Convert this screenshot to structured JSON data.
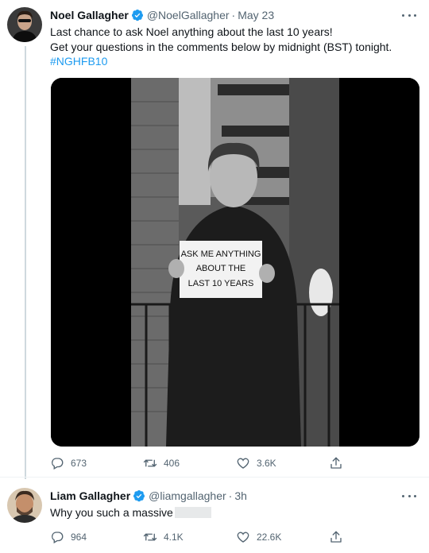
{
  "tweets": [
    {
      "author_name": "Noel Gallagher",
      "handle": "@NoelGallagher",
      "separator": "·",
      "time": "May 23",
      "text_line1": "Last chance to ask Noel anything about the last 10 years!",
      "text_line2": "Get your questions in the comments below by midnight (BST) tonight.",
      "hashtag": "#NGHFB10",
      "media_sign": [
        "ASK ME ANYTHING",
        "ABOUT THE",
        "LAST 10 YEARS"
      ],
      "replies": "673",
      "retweets": "406",
      "likes": "3.6K"
    },
    {
      "author_name": "Liam Gallagher",
      "handle": "@liamgallagher",
      "separator": "·",
      "time": "3h",
      "text": "Why you such a massive",
      "replies": "964",
      "retweets": "4.1K",
      "likes": "22.6K"
    }
  ],
  "colors": {
    "accent": "#1d9bf0",
    "text_secondary": "#536471",
    "divider": "#eff3f4",
    "thread_line": "#cfd9de"
  },
  "icons": [
    "more-icon",
    "verified-badge-icon",
    "reply-icon",
    "retweet-icon",
    "like-icon",
    "share-icon"
  ]
}
